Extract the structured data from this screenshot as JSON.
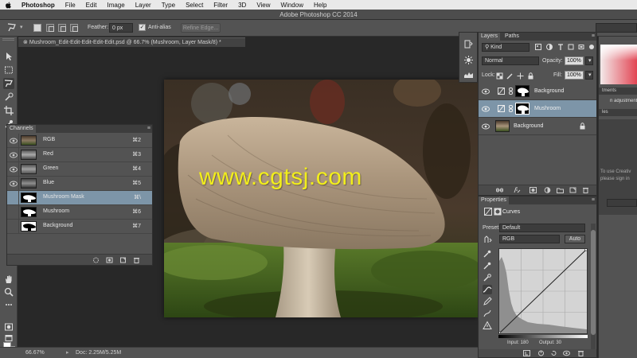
{
  "menubar": {
    "app_name": "Photoshop",
    "items": [
      "File",
      "Edit",
      "Image",
      "Layer",
      "Type",
      "Select",
      "Filter",
      "3D",
      "View",
      "Window",
      "Help"
    ]
  },
  "window": {
    "title": "Adobe Photoshop CC 2014"
  },
  "options_bar": {
    "feather_label": "Feather:",
    "feather_value": "0 px",
    "antialias_label": "Anti-alias",
    "antialias_checked": true,
    "refine_edge_label": "Refine Edge..."
  },
  "document": {
    "tab_label": "Mushroom_Edit-Edit-Edit-Edit-Edit.psd @ 66.7% (Mushroom, Layer Mask/8) *",
    "watermark": "www.cgtsj.com"
  },
  "status": {
    "zoom": "66.67%",
    "doc_size": "Doc: 2.25M/5.25M"
  },
  "channels": {
    "title": "Channels",
    "items": [
      {
        "name": "RGB",
        "shortcut": "⌘2"
      },
      {
        "name": "Red",
        "shortcut": "⌘3"
      },
      {
        "name": "Green",
        "shortcut": "⌘4"
      },
      {
        "name": "Blue",
        "shortcut": "⌘5"
      },
      {
        "name": "Mushroom Mask",
        "shortcut": "⌘\\",
        "selected": true
      },
      {
        "name": "Mushroom",
        "shortcut": "⌘6"
      },
      {
        "name": "Background",
        "shortcut": "⌘7"
      }
    ]
  },
  "layers": {
    "tabs": [
      "Layers",
      "Paths"
    ],
    "filter_kind": "Kind",
    "blend_mode": "Normal",
    "opacity_label": "Opacity:",
    "opacity_value": "100%",
    "lock_label": "Lock:",
    "fill_label": "Fill:",
    "fill_value": "100%",
    "items": [
      {
        "name": "Background",
        "type": "adjustment-mask"
      },
      {
        "name": "Mushroom",
        "type": "adjustment-mask",
        "selected": true
      },
      {
        "name": "Background",
        "type": "image",
        "locked": true
      }
    ]
  },
  "properties": {
    "title": "Properties",
    "panel_name": "Curves",
    "preset_label": "Preset:",
    "preset_value": "Default",
    "channel_value": "RGB",
    "auto_label": "Auto",
    "input_label": "Input: 180",
    "output_label": "Output: 30"
  },
  "right_edge": {
    "adjust_tab": "tments",
    "adjust_sub": "n adjustment",
    "styles_tab": "les",
    "creative_line1": "To use Creativ",
    "creative_line2": "please sign in"
  },
  "colors": {
    "panel_bg": "#535353",
    "panel_dark": "#3d3d3d",
    "selection": "#7d95a8",
    "watermark": "#f2ee1b",
    "foreground": "#ffffff",
    "background": "#000000"
  }
}
